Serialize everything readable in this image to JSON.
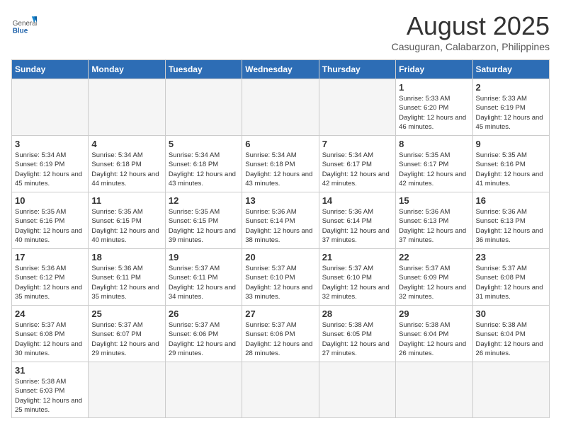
{
  "header": {
    "logo_general": "General",
    "logo_blue": "Blue",
    "title": "August 2025",
    "subtitle": "Casuguran, Calabarzon, Philippines"
  },
  "weekdays": [
    "Sunday",
    "Monday",
    "Tuesday",
    "Wednesday",
    "Thursday",
    "Friday",
    "Saturday"
  ],
  "weeks": [
    [
      {
        "day": "",
        "info": ""
      },
      {
        "day": "",
        "info": ""
      },
      {
        "day": "",
        "info": ""
      },
      {
        "day": "",
        "info": ""
      },
      {
        "day": "",
        "info": ""
      },
      {
        "day": "1",
        "info": "Sunrise: 5:33 AM\nSunset: 6:20 PM\nDaylight: 12 hours and 46 minutes."
      },
      {
        "day": "2",
        "info": "Sunrise: 5:33 AM\nSunset: 6:19 PM\nDaylight: 12 hours and 45 minutes."
      }
    ],
    [
      {
        "day": "3",
        "info": "Sunrise: 5:34 AM\nSunset: 6:19 PM\nDaylight: 12 hours and 45 minutes."
      },
      {
        "day": "4",
        "info": "Sunrise: 5:34 AM\nSunset: 6:18 PM\nDaylight: 12 hours and 44 minutes."
      },
      {
        "day": "5",
        "info": "Sunrise: 5:34 AM\nSunset: 6:18 PM\nDaylight: 12 hours and 43 minutes."
      },
      {
        "day": "6",
        "info": "Sunrise: 5:34 AM\nSunset: 6:18 PM\nDaylight: 12 hours and 43 minutes."
      },
      {
        "day": "7",
        "info": "Sunrise: 5:34 AM\nSunset: 6:17 PM\nDaylight: 12 hours and 42 minutes."
      },
      {
        "day": "8",
        "info": "Sunrise: 5:35 AM\nSunset: 6:17 PM\nDaylight: 12 hours and 42 minutes."
      },
      {
        "day": "9",
        "info": "Sunrise: 5:35 AM\nSunset: 6:16 PM\nDaylight: 12 hours and 41 minutes."
      }
    ],
    [
      {
        "day": "10",
        "info": "Sunrise: 5:35 AM\nSunset: 6:16 PM\nDaylight: 12 hours and 40 minutes."
      },
      {
        "day": "11",
        "info": "Sunrise: 5:35 AM\nSunset: 6:15 PM\nDaylight: 12 hours and 40 minutes."
      },
      {
        "day": "12",
        "info": "Sunrise: 5:35 AM\nSunset: 6:15 PM\nDaylight: 12 hours and 39 minutes."
      },
      {
        "day": "13",
        "info": "Sunrise: 5:36 AM\nSunset: 6:14 PM\nDaylight: 12 hours and 38 minutes."
      },
      {
        "day": "14",
        "info": "Sunrise: 5:36 AM\nSunset: 6:14 PM\nDaylight: 12 hours and 37 minutes."
      },
      {
        "day": "15",
        "info": "Sunrise: 5:36 AM\nSunset: 6:13 PM\nDaylight: 12 hours and 37 minutes."
      },
      {
        "day": "16",
        "info": "Sunrise: 5:36 AM\nSunset: 6:13 PM\nDaylight: 12 hours and 36 minutes."
      }
    ],
    [
      {
        "day": "17",
        "info": "Sunrise: 5:36 AM\nSunset: 6:12 PM\nDaylight: 12 hours and 35 minutes."
      },
      {
        "day": "18",
        "info": "Sunrise: 5:36 AM\nSunset: 6:11 PM\nDaylight: 12 hours and 35 minutes."
      },
      {
        "day": "19",
        "info": "Sunrise: 5:37 AM\nSunset: 6:11 PM\nDaylight: 12 hours and 34 minutes."
      },
      {
        "day": "20",
        "info": "Sunrise: 5:37 AM\nSunset: 6:10 PM\nDaylight: 12 hours and 33 minutes."
      },
      {
        "day": "21",
        "info": "Sunrise: 5:37 AM\nSunset: 6:10 PM\nDaylight: 12 hours and 32 minutes."
      },
      {
        "day": "22",
        "info": "Sunrise: 5:37 AM\nSunset: 6:09 PM\nDaylight: 12 hours and 32 minutes."
      },
      {
        "day": "23",
        "info": "Sunrise: 5:37 AM\nSunset: 6:08 PM\nDaylight: 12 hours and 31 minutes."
      }
    ],
    [
      {
        "day": "24",
        "info": "Sunrise: 5:37 AM\nSunset: 6:08 PM\nDaylight: 12 hours and 30 minutes."
      },
      {
        "day": "25",
        "info": "Sunrise: 5:37 AM\nSunset: 6:07 PM\nDaylight: 12 hours and 29 minutes."
      },
      {
        "day": "26",
        "info": "Sunrise: 5:37 AM\nSunset: 6:06 PM\nDaylight: 12 hours and 29 minutes."
      },
      {
        "day": "27",
        "info": "Sunrise: 5:37 AM\nSunset: 6:06 PM\nDaylight: 12 hours and 28 minutes."
      },
      {
        "day": "28",
        "info": "Sunrise: 5:38 AM\nSunset: 6:05 PM\nDaylight: 12 hours and 27 minutes."
      },
      {
        "day": "29",
        "info": "Sunrise: 5:38 AM\nSunset: 6:04 PM\nDaylight: 12 hours and 26 minutes."
      },
      {
        "day": "30",
        "info": "Sunrise: 5:38 AM\nSunset: 6:04 PM\nDaylight: 12 hours and 26 minutes."
      }
    ],
    [
      {
        "day": "31",
        "info": "Sunrise: 5:38 AM\nSunset: 6:03 PM\nDaylight: 12 hours and 25 minutes."
      },
      {
        "day": "",
        "info": ""
      },
      {
        "day": "",
        "info": ""
      },
      {
        "day": "",
        "info": ""
      },
      {
        "day": "",
        "info": ""
      },
      {
        "day": "",
        "info": ""
      },
      {
        "day": "",
        "info": ""
      }
    ]
  ]
}
